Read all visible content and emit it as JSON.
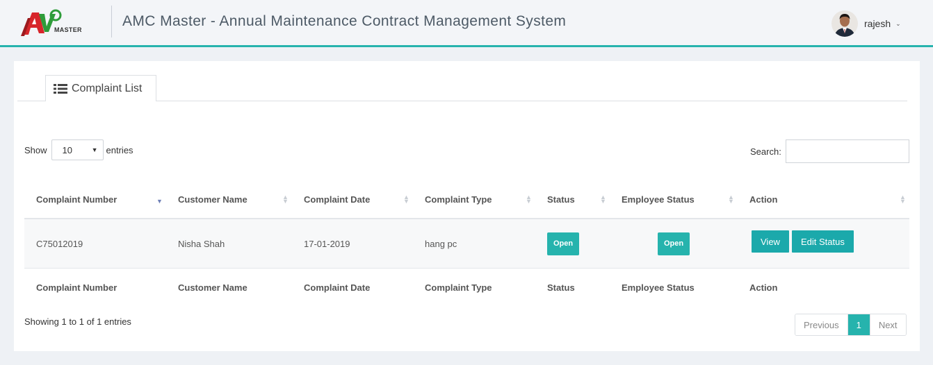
{
  "header": {
    "logo_text": "MASTER",
    "logo_mark": "AMC",
    "title": "AMC Master - Annual Maintenance Contract Management System",
    "user_name": "rajesh"
  },
  "tab": {
    "label": "Complaint List",
    "icon": "list-icon"
  },
  "length_menu": {
    "prefix": "Show",
    "value": "10",
    "suffix": "entries"
  },
  "search": {
    "label": "Search:",
    "value": ""
  },
  "table": {
    "columns": [
      "Complaint Number",
      "Customer Name",
      "Complaint Date",
      "Complaint Type",
      "Status",
      "Employee Status",
      "Action"
    ],
    "rows": [
      {
        "complaint_number": "C75012019",
        "customer_name": "Nisha Shah",
        "complaint_date": "17-01-2019",
        "complaint_type": "hang pc",
        "status": "Open",
        "employee_status": "Open",
        "actions": [
          "View",
          "Edit Status"
        ]
      }
    ]
  },
  "info": "Showing 1 to 1 of 1 entries",
  "pagination": {
    "previous": "Previous",
    "current": "1",
    "next": "Next"
  },
  "colors": {
    "accent": "#26b3ad",
    "button": "#1ba9ab",
    "header_bg": "#f3f5f8",
    "page_bg": "#eef1f5"
  }
}
